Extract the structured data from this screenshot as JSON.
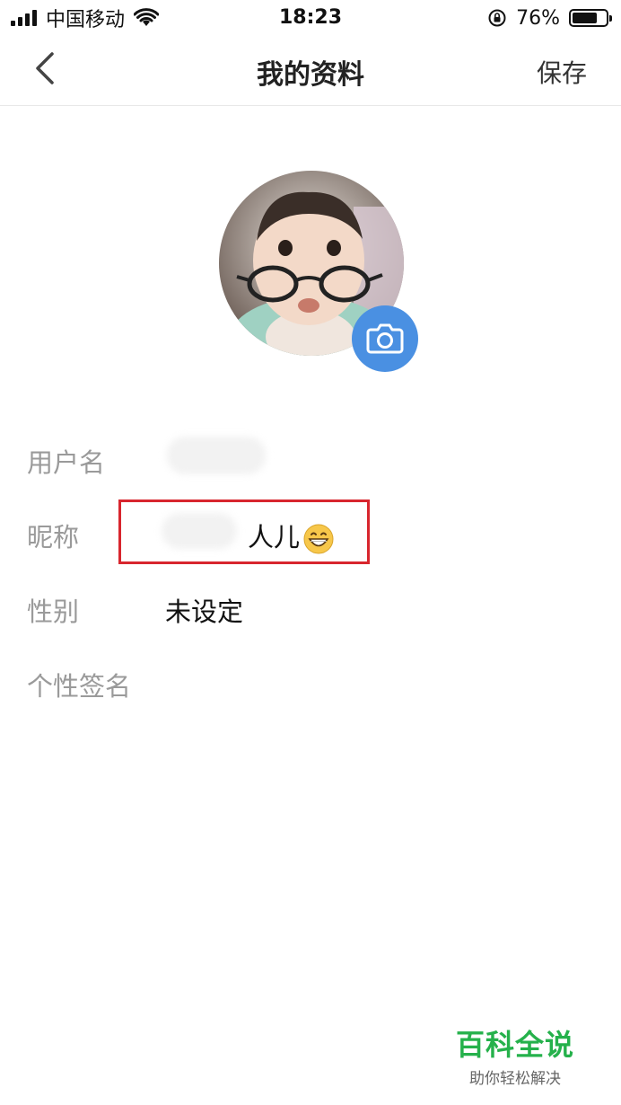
{
  "status_bar": {
    "carrier": "中国移动",
    "time": "18:23",
    "battery_percent": "76%",
    "battery_level": 0.76
  },
  "nav": {
    "title": "我的资料",
    "save_label": "保存"
  },
  "profile": {
    "username_label": "用户名",
    "nickname_label": "昵称",
    "nickname_visible": "人儿",
    "gender_label": "性别",
    "gender_value": "未设定",
    "signature_label": "个性签名"
  },
  "watermark": {
    "title": "百科全说",
    "subtitle": "助你轻松解决"
  },
  "icons": {
    "back": "chevron-left-icon",
    "camera": "camera-icon",
    "wifi": "wifi-icon",
    "signal": "signal-icon",
    "rotation_lock": "rotation-lock-icon",
    "battery": "battery-icon",
    "emoji": "grinning-face-icon"
  },
  "colors": {
    "accent_blue": "#4a90e2",
    "highlight_red": "#d8262e",
    "watermark_green": "#25b14b",
    "label_gray": "#9a9a9a"
  }
}
